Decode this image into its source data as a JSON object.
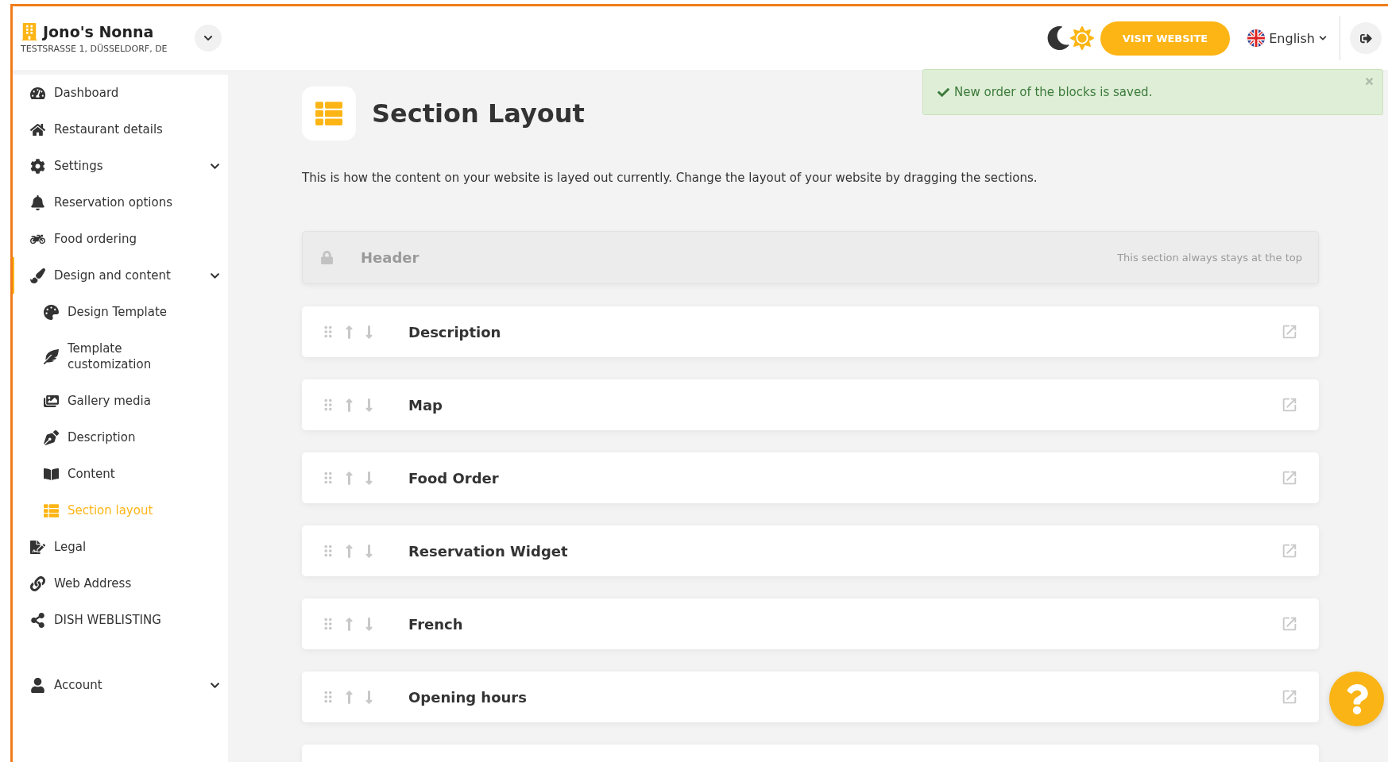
{
  "brand": {
    "name": "Jono's Nonna",
    "address": "TESTSRASSE 1, DÜSSELDORF, DE"
  },
  "topbar": {
    "visit_button": "VISIT WEBSITE",
    "language": "English"
  },
  "toast": {
    "message": "New order of the blocks is saved."
  },
  "sidebar": {
    "items": [
      {
        "label": "Dashboard",
        "kind": "link",
        "selected": false
      },
      {
        "label": "Restaurant details",
        "kind": "link",
        "selected": false
      },
      {
        "label": "Settings",
        "kind": "group",
        "selected": false
      },
      {
        "label": "Reservation options",
        "kind": "link",
        "selected": false
      },
      {
        "label": "Food ordering",
        "kind": "link",
        "selected": false
      },
      {
        "label": "Design and content",
        "kind": "group",
        "selected": false,
        "children": [
          {
            "label": "Design Template",
            "selected": false
          },
          {
            "label": "Template customization",
            "selected": false
          },
          {
            "label": "Gallery media",
            "selected": false
          },
          {
            "label": "Description",
            "selected": false
          },
          {
            "label": "Content",
            "selected": false
          },
          {
            "label": "Section layout",
            "selected": true
          }
        ]
      },
      {
        "label": "Legal",
        "kind": "link",
        "selected": false
      },
      {
        "label": "Web Address",
        "kind": "link",
        "selected": false
      },
      {
        "label": "DISH WEBLISTING",
        "kind": "link",
        "selected": false
      }
    ],
    "account": {
      "label": "Account",
      "kind": "group",
      "selected": false
    }
  },
  "page": {
    "title": "Section Layout",
    "description": "This is how the content on your website is layed out currently. Change the layout of your website by dragging the sections."
  },
  "fixed_section": {
    "label": "Header",
    "note": "This section always stays at the top"
  },
  "sections": [
    {
      "label": "Description"
    },
    {
      "label": "Map"
    },
    {
      "label": "Food Order"
    },
    {
      "label": "Reservation Widget"
    },
    {
      "label": "French"
    },
    {
      "label": "Opening hours"
    }
  ]
}
